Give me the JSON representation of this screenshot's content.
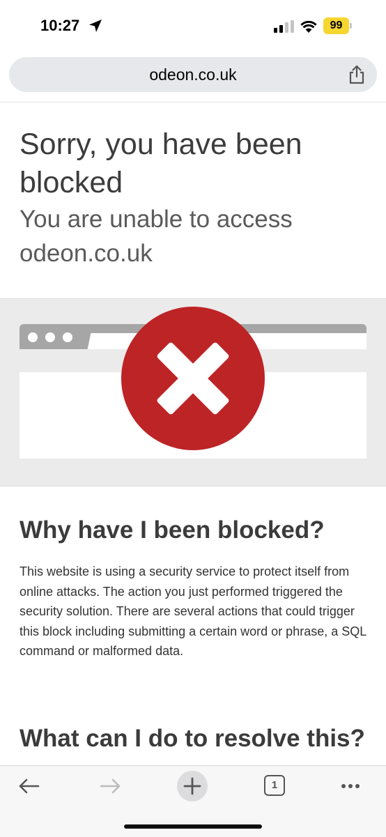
{
  "status_bar": {
    "time": "10:27",
    "battery": "99"
  },
  "browser": {
    "url": "odeon.co.uk",
    "tab_count": "1"
  },
  "page": {
    "title": "Sorry, you have been blocked",
    "subtitle": "You are unable to access odeon.co.uk",
    "section1_heading": "Why have I been blocked?",
    "section1_body": "This website is using a security service to protect itself from online attacks. The action you just performed triggered the security solution. There are several actions that could trigger this block including submitting a certain word or phrase, a SQL command or malformed data.",
    "section2_heading": "What can I do to resolve this?"
  },
  "icons": {
    "location": "location-arrow-icon",
    "signal": "cellular-signal-icon",
    "wifi": "wifi-icon",
    "share": "share-icon",
    "blocked": "blocked-x-icon",
    "back": "back-arrow-icon",
    "forward": "forward-arrow-icon",
    "new_tab": "plus-icon",
    "tabs": "tabs-icon",
    "more": "more-icon"
  },
  "colors": {
    "accent_red": "#bd2426",
    "battery_yellow": "#f6d630"
  }
}
